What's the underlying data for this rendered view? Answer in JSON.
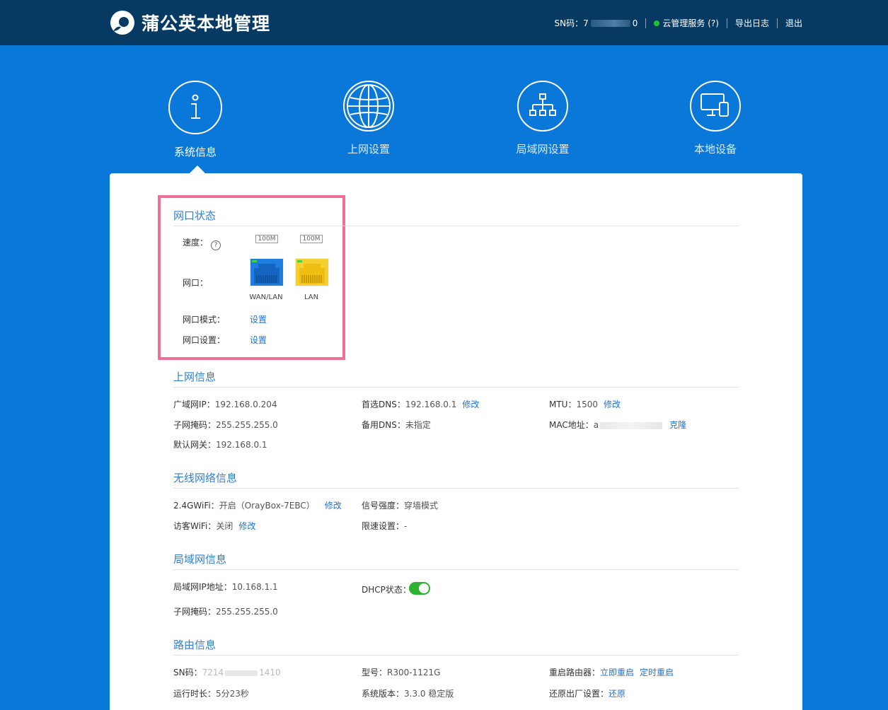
{
  "header": {
    "title": "蒲公英本地管理",
    "sn_label": "SN码：7",
    "sn_tail": "0",
    "cloud_service": "云管理服务 (?)",
    "export_log": "导出日志",
    "logout": "退出",
    "status_color": "#22c12e"
  },
  "nav": [
    {
      "label": "系统信息",
      "icon": "info-icon",
      "active": true
    },
    {
      "label": "上网设置",
      "icon": "globe-icon"
    },
    {
      "label": "局域网设置",
      "icon": "network-tree-icon"
    },
    {
      "label": "本地设备",
      "icon": "devices-icon"
    }
  ],
  "port_status": {
    "title": "网口状态",
    "speed_label": "速度：",
    "speed_help": "?",
    "ports": [
      {
        "name": "WAN/LAN",
        "speed": "100M",
        "color": "#1e7ee0"
      },
      {
        "name": "LAN",
        "speed": "100M",
        "color": "#f5cf2f"
      }
    ],
    "port_label": "网口：",
    "mode_label": "网口模式：",
    "mode_link": "设置",
    "settings_label": "网口设置：",
    "settings_link": "设置"
  },
  "internet": {
    "title": "上网信息",
    "wan_ip_label": "广域网IP：",
    "wan_ip": "192.168.0.204",
    "mask_label": "子网掩码：",
    "mask": "255.255.255.0",
    "gateway_label": "默认网关：",
    "gateway": "192.168.0.1",
    "dns1_label": "首选DNS：",
    "dns1": "192.168.0.1",
    "dns1_link": "修改",
    "dns2_label": "备用DNS：",
    "dns2": "未指定",
    "mtu_label": "MTU：",
    "mtu": "1500",
    "mtu_link": "修改",
    "mac_label": "MAC地址：",
    "mac_head": "a",
    "mac_link": "克隆"
  },
  "wireless": {
    "title": "无线网络信息",
    "wifi24_label": "2.4GWiFi：",
    "wifi24": "开启（OrayBox-7EBC）",
    "wifi24_link": "修改",
    "guest_label": "访客WiFi：",
    "guest": "关闭",
    "guest_link": "修改",
    "signal_label": "信号强度：",
    "signal": "穿墙模式",
    "limit_label": "限速设置：",
    "limit": "-"
  },
  "lan": {
    "title": "局域网信息",
    "lan_ip_label": "局域网IP地址：",
    "lan_ip": "10.168.1.1",
    "mask_label": "子网掩码：",
    "mask": "255.255.255.0",
    "dhcp_label": "DHCP状态：",
    "dhcp_on": true
  },
  "router": {
    "title": "路由信息",
    "sn_label": "SN码：",
    "sn_head": "7214",
    "sn_tail": "1410",
    "model_label": "型号：",
    "model": "R300-1121G",
    "restart_label": "重启路由器：",
    "restart_now": "立即重启",
    "restart_timed": "定时重启",
    "uptime_label": "运行时长：",
    "uptime": "5分23秒",
    "version_label": "系统版本：",
    "version": "3.3.0 稳定版",
    "factory_label": "还原出厂设置：",
    "factory_link": "还原"
  }
}
